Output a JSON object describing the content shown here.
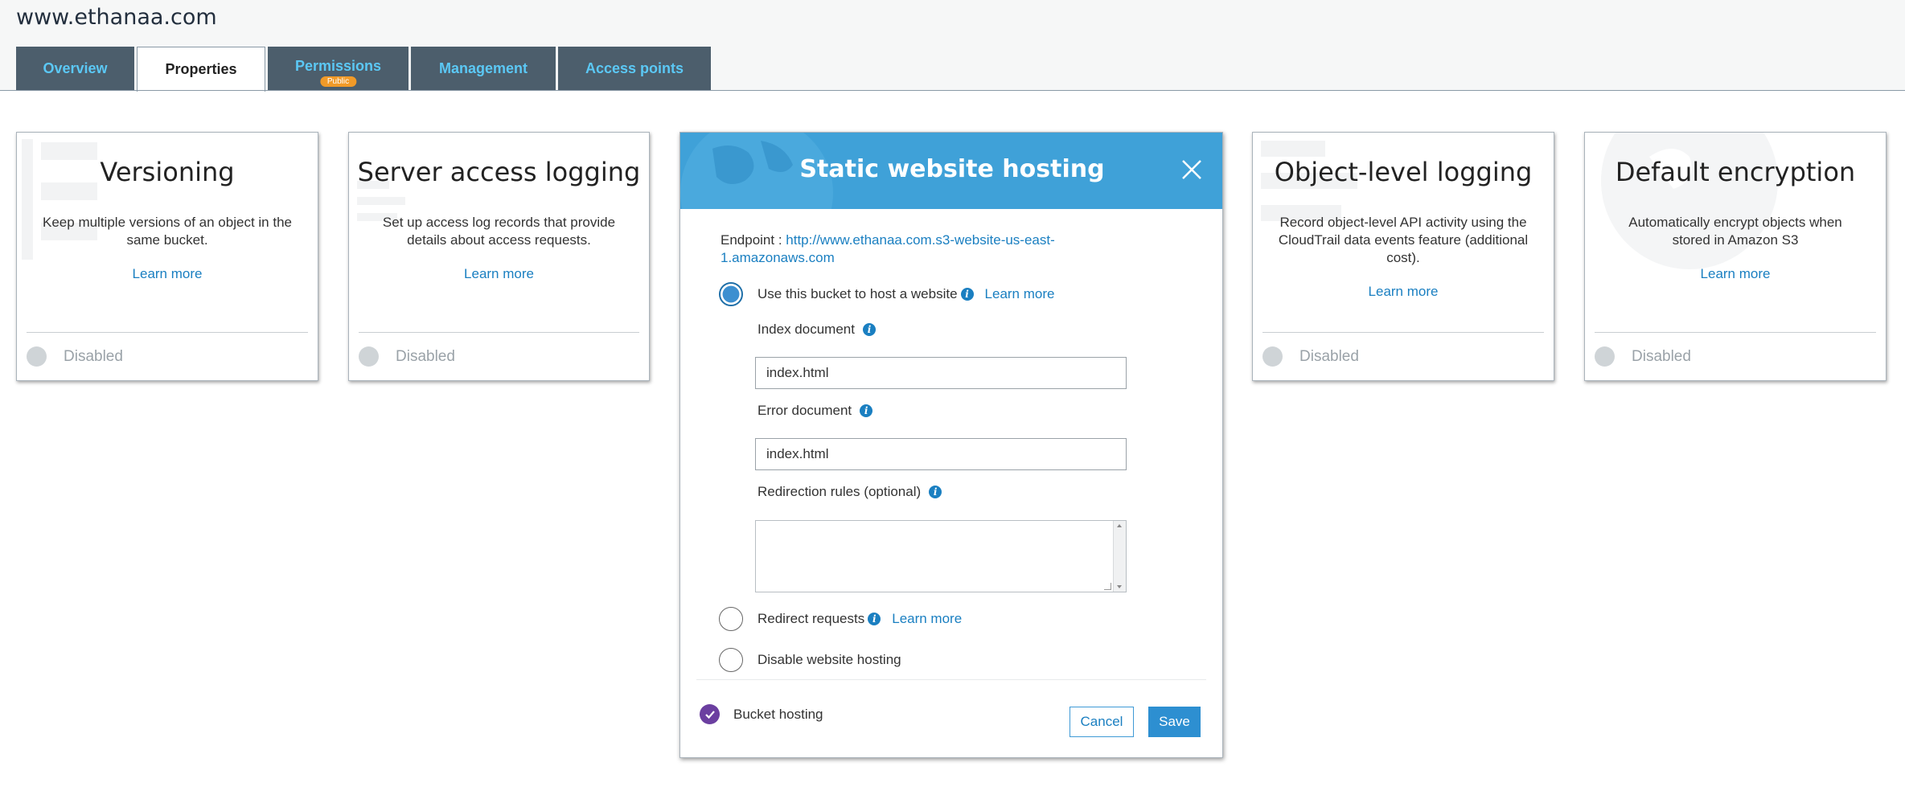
{
  "bucket": {
    "name": "www.ethanaa.com"
  },
  "tabs": [
    {
      "label": "Overview"
    },
    {
      "label": "Properties"
    },
    {
      "label": "Permissions",
      "badge": "Public"
    },
    {
      "label": "Management"
    },
    {
      "label": "Access points"
    }
  ],
  "cards": {
    "versioning": {
      "title": "Versioning",
      "description": "Keep multiple versions of an object in the same bucket.",
      "link": "Learn more",
      "status": "Disabled"
    },
    "server_access_logging": {
      "title": "Server access logging",
      "description": "Set up access log records that provide details about access requests.",
      "link": "Learn more",
      "status": "Disabled"
    },
    "object_level_logging": {
      "title": "Object-level logging",
      "description": "Record object-level API activity using the CloudTrail data events feature (additional cost).",
      "link": "Learn more",
      "status": "Disabled"
    },
    "default_encryption": {
      "title": "Default encryption",
      "description": "Automatically encrypt objects when stored in Amazon S3",
      "link": "Learn more",
      "status": "Disabled"
    }
  },
  "modal": {
    "title": "Static website hosting",
    "endpoint_label": "Endpoint : ",
    "endpoint_url": "http://www.ethanaa.com.s3-website-us-east-1.amazonaws.com",
    "options": {
      "host": {
        "label": "Use this bucket to host a website",
        "link": "Learn more",
        "selected": true
      },
      "redirect": {
        "label": "Redirect requests",
        "link": "Learn more",
        "selected": false
      },
      "disable": {
        "label": "Disable website hosting",
        "selected": false
      }
    },
    "index_document": {
      "label": "Index document",
      "value": "index.html"
    },
    "error_document": {
      "label": "Error document",
      "value": "index.html"
    },
    "redirection_rules": {
      "label": "Redirection rules (optional)",
      "value": ""
    },
    "bucket_hosting": {
      "label": "Bucket hosting",
      "checked": true
    },
    "buttons": {
      "cancel": "Cancel",
      "save": "Save"
    }
  },
  "colors": {
    "tab_bg": "#4c5e6c",
    "tab_text": "#5bc8f5",
    "modal_header": "#3fa1d8",
    "link": "#1a7fc1",
    "badge": "#f19a28",
    "check": "#6b3fa0"
  },
  "icons": [
    "close-icon",
    "info-icon",
    "check-icon",
    "status-disabled-icon"
  ]
}
